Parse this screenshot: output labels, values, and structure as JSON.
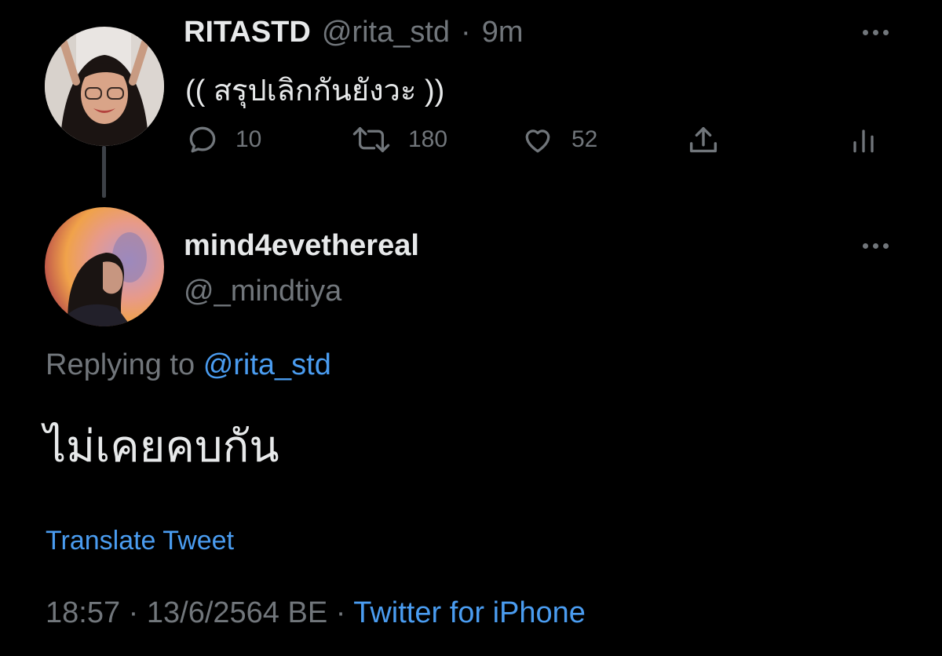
{
  "original_tweet": {
    "display_name": "RITASTD",
    "handle": "@rita_std",
    "separator": "·",
    "time": "9m",
    "text": "(( สรุปเลิกกันยังวะ ))",
    "actions": {
      "reply_count": "10",
      "retweet_count": "180",
      "like_count": "52"
    }
  },
  "reply_tweet": {
    "display_name": "mind4evethereal",
    "handle": "@_mindtiya",
    "replying_label": "Replying to",
    "replying_handle": "@rita_std",
    "text": "ไม่เคยคบกัน",
    "translate_label": "Translate Tweet",
    "timestamp": "18:57 · 13/6/2564 BE ·",
    "source": "Twitter for iPhone"
  },
  "colors": {
    "background": "#000000",
    "text": "#e7e9ea",
    "muted": "#71767b",
    "link": "#4a9cf0"
  },
  "icons": [
    "reply-icon",
    "retweet-icon",
    "like-icon",
    "share-icon",
    "analytics-icon",
    "more-icon"
  ]
}
